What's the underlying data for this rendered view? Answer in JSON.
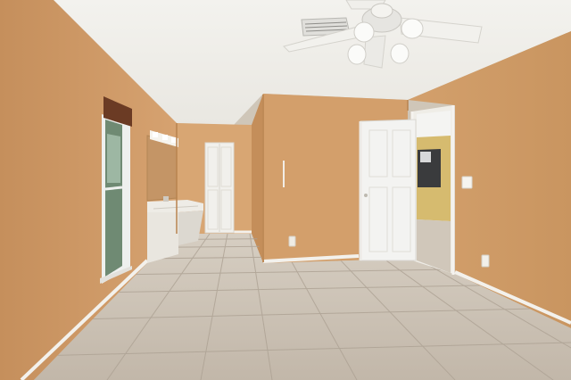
{
  "scene": {
    "kind": "empty interior room photo",
    "colors": {
      "wall": "#cf9a66",
      "wall_shadow": "#b9834f",
      "ceiling": "#f1f0ec",
      "floor_tile": "#c9bfb2",
      "grout": "#a89e92",
      "trim": "#f4f2ee",
      "door": "#f3f3f1",
      "kitchen_wall": "#d8bd73"
    },
    "objects": [
      "ceiling-fan",
      "air-vent",
      "window-with-blind",
      "vanity-with-sink",
      "vanity-mirror",
      "vanity-light",
      "closet-door",
      "interior-door-open",
      "kitchen-doorway",
      "light-switch",
      "wall-outlet",
      "tile-floor",
      "baseboard"
    ]
  }
}
